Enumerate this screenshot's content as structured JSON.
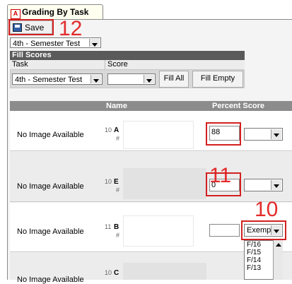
{
  "tab": {
    "title": "Grading By Task",
    "icon": "assignment-icon"
  },
  "toolbar": {
    "save_label": "Save"
  },
  "top_task_select": {
    "value": "4th - Semester Test"
  },
  "fill_scores": {
    "header": "Fill Scores",
    "task_label": "Task",
    "score_label": "Score",
    "task_value": "4th - Semester Test",
    "score_value": "",
    "fill_all_label": "Fill All",
    "fill_empty_label": "Fill Empty"
  },
  "grid": {
    "name_header": "Name",
    "score_header": "Percent Score",
    "rows": [
      {
        "no_image": "No Image Available",
        "grade": "10",
        "initial": "A",
        "id_prefix": "#",
        "score": "88",
        "mark": ""
      },
      {
        "no_image": "No Image Available",
        "grade": "10",
        "initial": "E",
        "id_prefix": "#",
        "score": "0",
        "mark": ""
      },
      {
        "no_image": "No Image Available",
        "grade": "11",
        "initial": "B",
        "id_prefix": "#",
        "score": "",
        "mark": "Exempt"
      },
      {
        "no_image": "No Image Available",
        "grade": "10",
        "initial": "C",
        "id_prefix": "",
        "score": "",
        "mark": ""
      }
    ]
  },
  "dropdown_options": [
    "F/16",
    "F/15",
    "F/14",
    "F/13"
  ],
  "callouts": [
    "12",
    "11",
    "10"
  ]
}
